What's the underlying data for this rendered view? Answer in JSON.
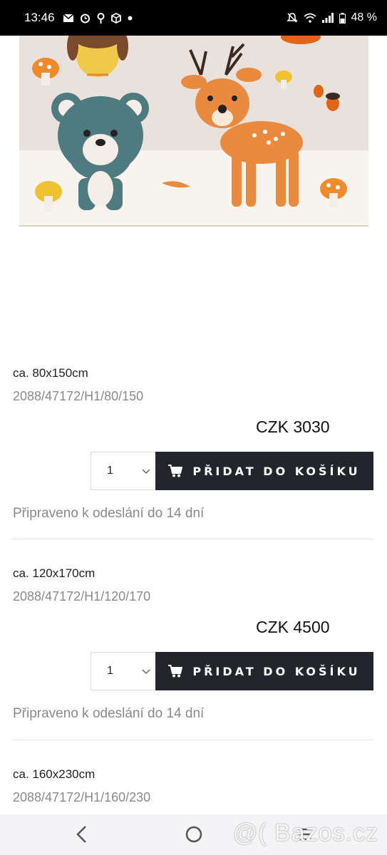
{
  "status_bar": {
    "time": "13:46",
    "battery": "48 %"
  },
  "product_image": {
    "alt": "kids rug with bear and deer"
  },
  "variants": [
    {
      "size": "ca. 80x150cm",
      "sku": "2088/47172/H1/80/150",
      "price": "CZK 3030",
      "qty": "1",
      "cart_label": "PŘIDAT DO KOŠÍKU",
      "availability": "Připraveno k odeslání do 14 dní"
    },
    {
      "size": "ca. 120x170cm",
      "sku": "2088/47172/H1/120/170",
      "price": "CZK 4500",
      "qty": "1",
      "cart_label": "PŘIDAT DO KOŠÍKU",
      "availability": "Připraveno k odeslání do 14 dní"
    },
    {
      "size": "ca. 160x230cm",
      "sku": "2088/47172/H1/160/230"
    }
  ],
  "watermark": "@( Bazos.cz",
  "colors": {
    "cart_button": "#22252b",
    "muted_text": "#8a8a8a",
    "divider": "#e3e3e3"
  }
}
